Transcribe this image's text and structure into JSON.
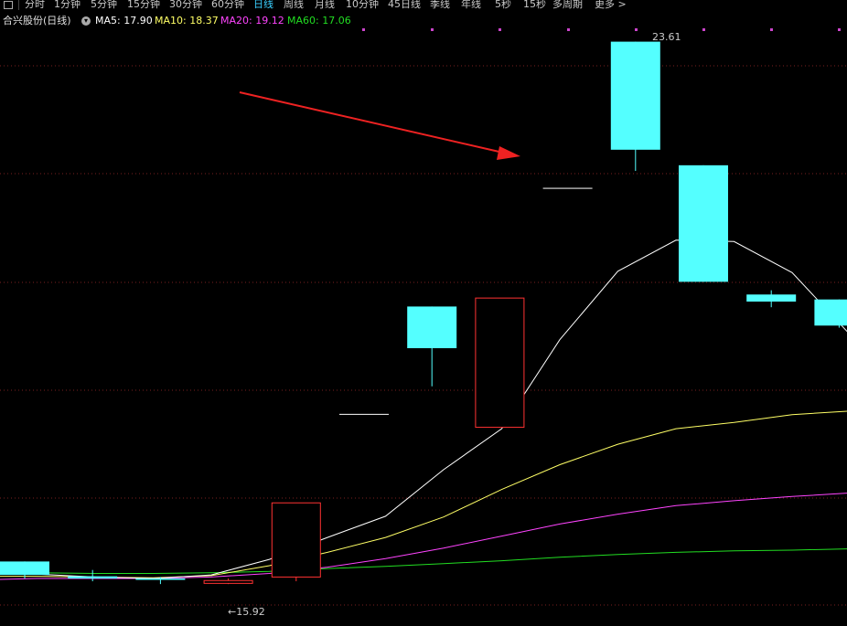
{
  "period_tabs": [
    {
      "label": "分时",
      "active": false
    },
    {
      "label": "1分钟",
      "active": false
    },
    {
      "label": "5分钟",
      "active": false
    },
    {
      "label": "15分钟",
      "active": false
    },
    {
      "label": "30分钟",
      "active": false
    },
    {
      "label": "60分钟",
      "active": false
    },
    {
      "label": "日线",
      "active": true
    },
    {
      "label": "周线",
      "active": false
    },
    {
      "label": "月线",
      "active": false
    },
    {
      "label": "10分钟",
      "active": false
    },
    {
      "label": "45日线",
      "active": false
    },
    {
      "label": "季线",
      "active": false
    },
    {
      "label": "年线",
      "active": false
    },
    {
      "label": "5秒",
      "active": false
    },
    {
      "label": "15秒",
      "active": false
    },
    {
      "label": "多周期",
      "active": false
    },
    {
      "label": "更多 >",
      "active": false
    }
  ],
  "header": {
    "stock_title": "合兴股份(日线)",
    "ma5": "MA5: 17.90",
    "ma10": "MA10: 18.37",
    "ma20": "MA20: 19.12",
    "ma60": "MA60: 17.06"
  },
  "colors": {
    "up": "#ff3232",
    "down": "#54ffff",
    "ma5": "#ffffff",
    "ma10": "#ffff66",
    "ma20": "#ff44ff",
    "ma60": "#22dd22",
    "grid": "#7a1f1f",
    "arrow": "#ee2222",
    "active_tab": "#3ad0ff"
  },
  "chart_data": {
    "type": "candlestick",
    "ylim": [
      15.65,
      23.75
    ],
    "grid": true,
    "high_label": "23.61",
    "low_label": "←15.92",
    "candles": [
      {
        "open": 16.24,
        "close": 16.05,
        "high": 16.24,
        "low": 16.0
      },
      {
        "open": 16.03,
        "close": 16.0,
        "high": 16.12,
        "low": 15.96
      },
      {
        "open": 16.0,
        "close": 15.98,
        "high": 16.02,
        "low": 15.92
      },
      {
        "open": 15.93,
        "close": 15.97,
        "high": 16.0,
        "low": 15.92
      },
      {
        "open": 16.02,
        "close": 17.07,
        "high": 17.07,
        "low": 15.96
      },
      {
        "open": 18.33,
        "close": 18.33,
        "high": 18.33,
        "low": 18.33
      },
      {
        "open": 19.85,
        "close": 19.26,
        "high": 19.85,
        "low": 18.72
      },
      {
        "open": 18.14,
        "close": 19.97,
        "high": 19.97,
        "low": 18.14
      },
      {
        "open": 21.53,
        "close": 21.53,
        "high": 21.53,
        "low": 21.53
      },
      {
        "open": 23.6,
        "close": 22.07,
        "high": 23.6,
        "low": 21.77
      },
      {
        "open": 21.85,
        "close": 20.2,
        "high": 21.85,
        "low": 20.2
      },
      {
        "open": 20.02,
        "close": 19.92,
        "high": 20.08,
        "low": 19.84
      },
      {
        "open": 19.95,
        "close": 19.58,
        "high": 19.95,
        "low": 19.55
      }
    ],
    "ma5": [
      16.08,
      16.06,
      16.02,
      16.0,
      16.05,
      16.27,
      16.58,
      16.88,
      17.54,
      18.12,
      19.38,
      20.35,
      20.79,
      20.77,
      20.33,
      19.45
    ],
    "ma10": [
      16.03,
      16.03,
      16.02,
      16.01,
      16.04,
      16.18,
      16.37,
      16.58,
      16.87,
      17.26,
      17.61,
      17.9,
      18.12,
      18.21,
      18.32,
      18.37
    ],
    "ma20": [
      15.98,
      16.0,
      16.0,
      16.0,
      16.02,
      16.07,
      16.16,
      16.28,
      16.43,
      16.6,
      16.77,
      16.91,
      17.03,
      17.1,
      17.16,
      17.21
    ],
    "ma60": [
      16.09,
      16.08,
      16.07,
      16.07,
      16.08,
      16.1,
      16.14,
      16.17,
      16.21,
      16.25,
      16.3,
      16.34,
      16.37,
      16.39,
      16.4,
      16.42
    ]
  }
}
